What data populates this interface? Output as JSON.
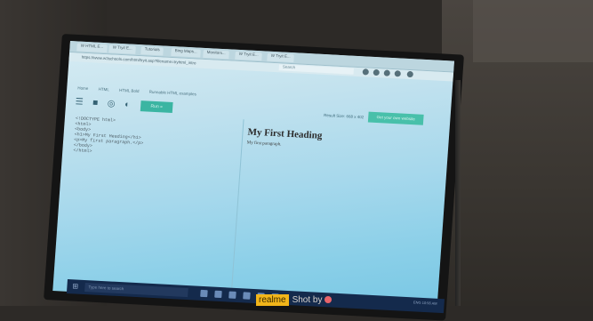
{
  "browser": {
    "tabs": [
      "W HTML E...",
      "W Tryit E...",
      "Tutorials",
      "Bing Maps...",
      "Monitors...",
      "W Tryit E...",
      "W Tryit E..."
    ],
    "url": "https://www.w3schools.com/html/tryit.asp?filename=tryhtml_intro",
    "search_placeholder": "Search"
  },
  "site_nav": [
    "Home",
    "HTML",
    "HTML Bold",
    "Runnable HTML examples"
  ],
  "editor": {
    "run_label": "Run »",
    "result_size": "Result Size: 668 x 402",
    "get_website_label": "Get your own website"
  },
  "code_lines": [
    "<!DOCTYPE html>",
    "<html>",
    "<body>",
    "",
    "<h1>My First Heading</h1>",
    "",
    "<p>My first paragraph.</p>",
    "",
    "</body>",
    "</html>"
  ],
  "result": {
    "heading": "My First Heading",
    "paragraph": "My first paragraph."
  },
  "taskbar": {
    "search_text": "Type here to search",
    "tray_text": "ENG  10:56 AM"
  },
  "watermark": {
    "brand": "realme",
    "text": "Shot by"
  },
  "colors": {
    "screen_top": "#d7ecf3",
    "screen_bottom": "#78c7e4",
    "run_button": "#3bb5a2",
    "taskbar": "#142a4c",
    "watermark_brand_bg": "#f2b51a"
  }
}
